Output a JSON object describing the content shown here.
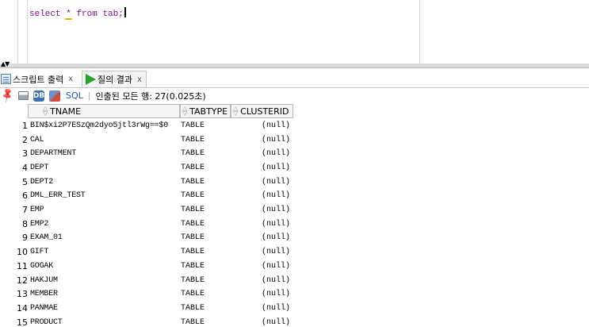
{
  "editor": {
    "sql_keyword_select": "select",
    "sql_star": "*",
    "sql_rest": "from tab;"
  },
  "splitter": {
    "arrows": "▲▼"
  },
  "tabs": [
    {
      "label": "스크립트 출력",
      "close": "x",
      "icon": "script-output-icon"
    },
    {
      "label": "질의 결과",
      "close": "x",
      "icon": "play-icon"
    }
  ],
  "toolbar": {
    "sql_label": "SQL",
    "separator": "|",
    "status": "인출된 모든 행: 27(0.025초)"
  },
  "grid": {
    "columns": [
      "TNAME",
      "TABTYPE",
      "CLUSTERID"
    ],
    "rows": [
      {
        "num": "1",
        "tname": "BIN$xi2P7ESzQm2dyo5jtl3rWg==$0",
        "ttype": "TABLE",
        "cid": "(null)"
      },
      {
        "num": "2",
        "tname": "CAL",
        "ttype": "TABLE",
        "cid": "(null)"
      },
      {
        "num": "3",
        "tname": "DEPARTMENT",
        "ttype": "TABLE",
        "cid": "(null)"
      },
      {
        "num": "4",
        "tname": "DEPT",
        "ttype": "TABLE",
        "cid": "(null)"
      },
      {
        "num": "5",
        "tname": "DEPT2",
        "ttype": "TABLE",
        "cid": "(null)"
      },
      {
        "num": "6",
        "tname": "DML_ERR_TEST",
        "ttype": "TABLE",
        "cid": "(null)"
      },
      {
        "num": "7",
        "tname": "EMP",
        "ttype": "TABLE",
        "cid": "(null)"
      },
      {
        "num": "8",
        "tname": "EMP2",
        "ttype": "TABLE",
        "cid": "(null)"
      },
      {
        "num": "9",
        "tname": "EXAM_01",
        "ttype": "TABLE",
        "cid": "(null)"
      },
      {
        "num": "10",
        "tname": "GIFT",
        "ttype": "TABLE",
        "cid": "(null)"
      },
      {
        "num": "11",
        "tname": "GOGAK",
        "ttype": "TABLE",
        "cid": "(null)"
      },
      {
        "num": "12",
        "tname": "HAKJUM",
        "ttype": "TABLE",
        "cid": "(null)"
      },
      {
        "num": "13",
        "tname": "MEMBER",
        "ttype": "TABLE",
        "cid": "(null)"
      },
      {
        "num": "14",
        "tname": "PANMAE",
        "ttype": "TABLE",
        "cid": "(null)"
      },
      {
        "num": "15",
        "tname": "PRODUCT",
        "ttype": "TABLE",
        "cid": "(null)"
      }
    ]
  }
}
